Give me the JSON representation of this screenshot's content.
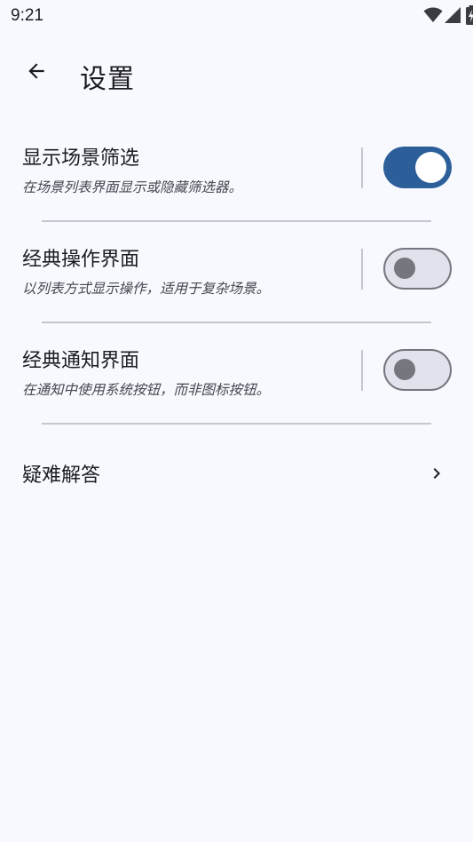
{
  "status_bar": {
    "time": "9:21",
    "icons": [
      "wifi-icon",
      "signal-icon",
      "battery-charging-icon"
    ]
  },
  "app_bar": {
    "back_icon": "arrow-back-icon",
    "title": "设置"
  },
  "settings": [
    {
      "title": "显示场景筛选",
      "description": "在场景列表界面显示或隐藏筛选器。",
      "enabled": true
    },
    {
      "title": "经典操作界面",
      "description": "以列表方式显示操作，适用于复杂场景。",
      "enabled": false
    },
    {
      "title": "经典通知界面",
      "description": "在通知中使用系统按钮，而非图标按钮。",
      "enabled": false
    }
  ],
  "faq": {
    "label": "疑难解答",
    "icon": "chevron-right-icon"
  },
  "colors": {
    "background": "#f8f9fe",
    "accent": "#2c5f9a",
    "switch_off_track": "#e1e2ec",
    "switch_off_outline": "#75777f",
    "divider": "#c5c6d0"
  }
}
